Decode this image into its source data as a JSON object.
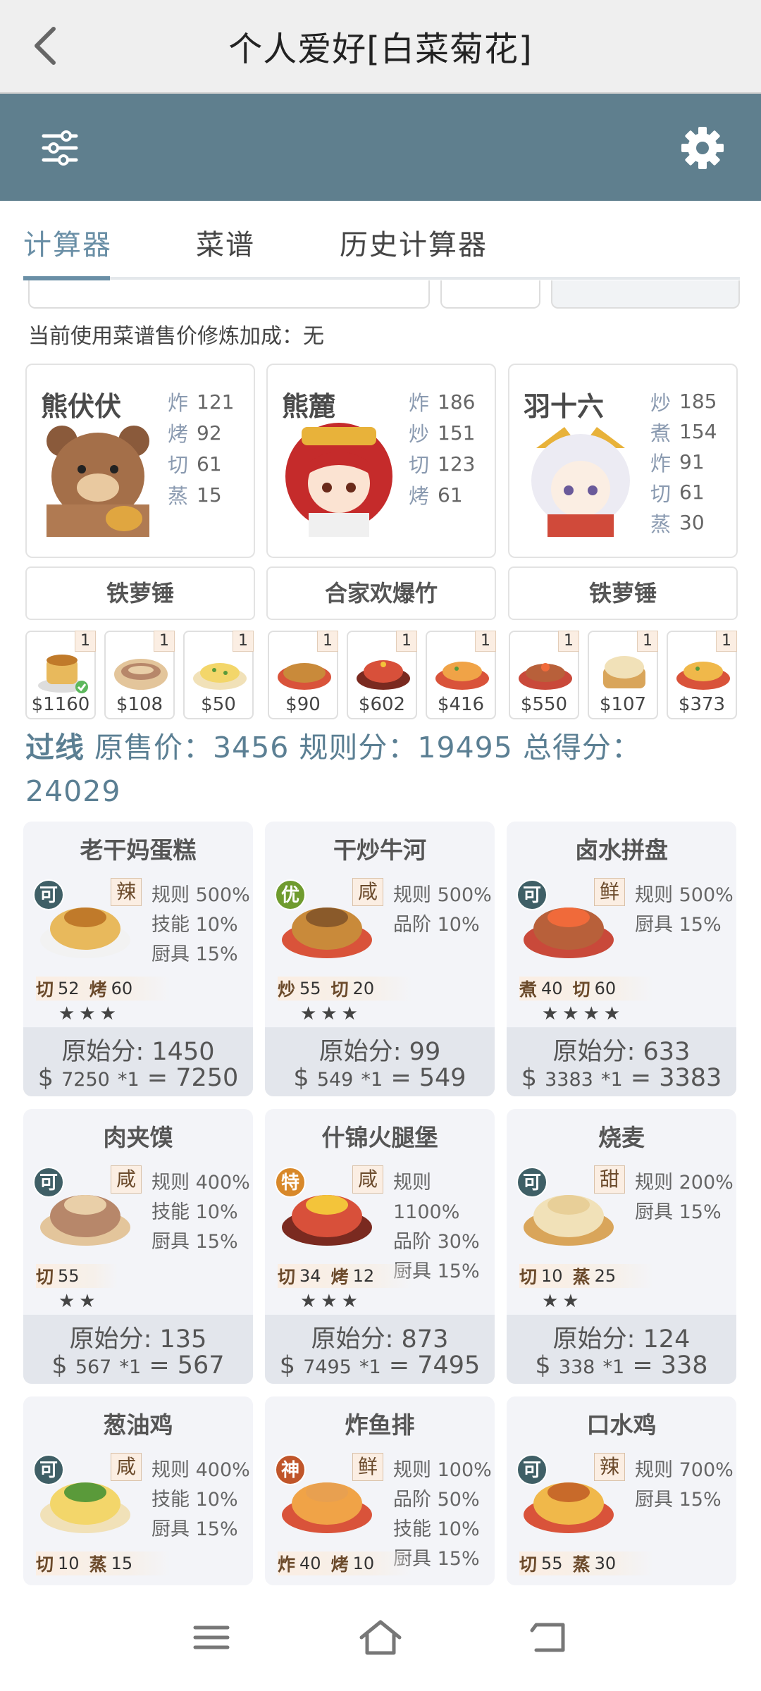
{
  "title": "个人爱好[白菜菊花]",
  "tabs": [
    {
      "label": "计算器",
      "active": true
    },
    {
      "label": "菜谱",
      "active": false
    },
    {
      "label": "历史计算器",
      "active": false
    }
  ],
  "bonus_line": "当前使用菜谱售价修炼加成：无",
  "chefs": [
    {
      "name": "熊伏伏",
      "stats": [
        {
          "k": "炸",
          "v": "121"
        },
        {
          "k": "烤",
          "v": "92"
        },
        {
          "k": "切",
          "v": "61"
        },
        {
          "k": "蒸",
          "v": "15"
        }
      ]
    },
    {
      "name": "熊麓",
      "stats": [
        {
          "k": "炸",
          "v": "186"
        },
        {
          "k": "炒",
          "v": "151"
        },
        {
          "k": "切",
          "v": "123"
        },
        {
          "k": "烤",
          "v": "61"
        }
      ]
    },
    {
      "name": "羽十六",
      "stats": [
        {
          "k": "炒",
          "v": "185"
        },
        {
          "k": "煮",
          "v": "154"
        },
        {
          "k": "炸",
          "v": "91"
        },
        {
          "k": "切",
          "v": "61"
        },
        {
          "k": "蒸",
          "v": "30"
        }
      ]
    }
  ],
  "tools": [
    "铁萝锤",
    "合家欢爆竹",
    "铁萝锤"
  ],
  "slots": [
    {
      "qty": "1",
      "price": "$1160"
    },
    {
      "qty": "1",
      "price": "$108"
    },
    {
      "qty": "1",
      "price": "$50"
    },
    {
      "qty": "1",
      "price": "$90"
    },
    {
      "qty": "1",
      "price": "$602"
    },
    {
      "qty": "1",
      "price": "$416"
    },
    {
      "qty": "1",
      "price": "$550"
    },
    {
      "qty": "1",
      "price": "$107"
    },
    {
      "qty": "1",
      "price": "$373"
    }
  ],
  "summary": {
    "status": "过线",
    "text": "原售价：3456 规则分：19495 总得分：24029"
  },
  "dishes": [
    {
      "name": "老干妈蛋糕",
      "rank": "可",
      "taste": "辣",
      "effects": [
        "规则 500%",
        "技能 10%",
        "厨具 15%"
      ],
      "skills": [
        {
          "k": "切",
          "v": "52"
        },
        {
          "k": "烤",
          "v": "60"
        }
      ],
      "stars": "★★★",
      "orig": "原始分: 1450",
      "price": "7250",
      "mult": "*1",
      "total": "7250"
    },
    {
      "name": "干炒牛河",
      "rank": "优",
      "taste": "咸",
      "effects": [
        "规则 500%",
        "品阶 10%"
      ],
      "skills": [
        {
          "k": "炒",
          "v": "55"
        },
        {
          "k": "切",
          "v": "20"
        }
      ],
      "stars": "★★★",
      "orig": "原始分: 99",
      "price": "549",
      "mult": "*1",
      "total": "549"
    },
    {
      "name": "卤水拼盘",
      "rank": "可",
      "taste": "鲜",
      "effects": [
        "规则 500%",
        "厨具 15%"
      ],
      "skills": [
        {
          "k": "煮",
          "v": "40"
        },
        {
          "k": "切",
          "v": "60"
        }
      ],
      "stars": "★★★★",
      "orig": "原始分: 633",
      "price": "3383",
      "mult": "*1",
      "total": "3383"
    },
    {
      "name": "肉夹馍",
      "rank": "可",
      "taste": "咸",
      "effects": [
        "规则 400%",
        "技能 10%",
        "厨具 15%"
      ],
      "skills": [
        {
          "k": "切",
          "v": "55"
        }
      ],
      "stars": "★★",
      "orig": "原始分: 135",
      "price": "567",
      "mult": "*1",
      "total": "567"
    },
    {
      "name": "什锦火腿堡",
      "rank": "特",
      "taste": "咸",
      "effects": [
        "规则 1100%",
        "品阶 30%",
        "厨具 15%"
      ],
      "skills": [
        {
          "k": "切",
          "v": "34"
        },
        {
          "k": "烤",
          "v": "12"
        }
      ],
      "stars": "★★★",
      "orig": "原始分: 873",
      "price": "7495",
      "mult": "*1",
      "total": "7495"
    },
    {
      "name": "烧麦",
      "rank": "可",
      "taste": "甜",
      "effects": [
        "规则 200%",
        "厨具 15%"
      ],
      "skills": [
        {
          "k": "切",
          "v": "10"
        },
        {
          "k": "蒸",
          "v": "25"
        }
      ],
      "stars": "★★",
      "orig": "原始分: 124",
      "price": "338",
      "mult": "*1",
      "total": "338"
    },
    {
      "name": "葱油鸡",
      "rank": "可",
      "taste": "咸",
      "effects": [
        "规则 400%",
        "技能 10%",
        "厨具 15%"
      ],
      "skills": [
        {
          "k": "切",
          "v": "10"
        },
        {
          "k": "蒸",
          "v": "15"
        }
      ],
      "stars": "",
      "orig": "",
      "price": "",
      "mult": "",
      "total": ""
    },
    {
      "name": "炸鱼排",
      "rank": "神",
      "taste": "鲜",
      "effects": [
        "规则 100%",
        "品阶 50%",
        "技能 10%",
        "厨具 15%"
      ],
      "skills": [
        {
          "k": "炸",
          "v": "40"
        },
        {
          "k": "烤",
          "v": "10"
        }
      ],
      "stars": "",
      "orig": "",
      "price": "",
      "mult": "",
      "total": ""
    },
    {
      "name": "口水鸡",
      "rank": "可",
      "taste": "辣",
      "effects": [
        "规则 700%",
        "厨具 15%"
      ],
      "skills": [
        {
          "k": "切",
          "v": "55"
        },
        {
          "k": "蒸",
          "v": "30"
        }
      ],
      "stars": "",
      "orig": "",
      "price": "",
      "mult": "",
      "total": ""
    }
  ],
  "colors": {
    "toolbar": "#5f7f8e",
    "accent": "#6a8fa6",
    "rank_ke": "#3f5f66",
    "rank_you": "#6f9b2e",
    "rank_te": "#d8882a",
    "rank_shen": "#c0552a"
  }
}
